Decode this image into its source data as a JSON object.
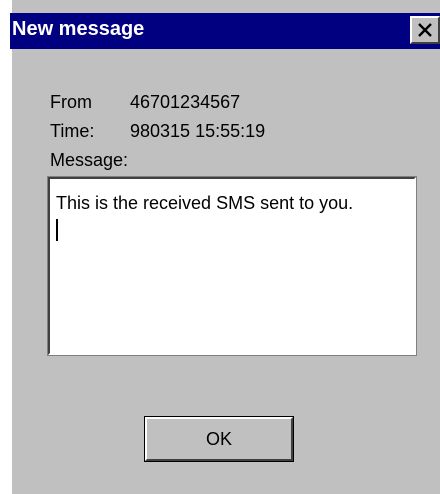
{
  "window": {
    "title": "New message",
    "close_icon": "close-icon"
  },
  "fields": {
    "from_label": "From",
    "from_value": "46701234567",
    "time_label": "Time:",
    "time_value": "980315 15:55:19",
    "message_label": "Message:"
  },
  "message": {
    "text": "This is the received SMS sent to you."
  },
  "buttons": {
    "ok_label": "OK"
  },
  "colors": {
    "titlebar": "#000080",
    "dialog_bg": "#c0c0c0",
    "text": "#000000"
  }
}
